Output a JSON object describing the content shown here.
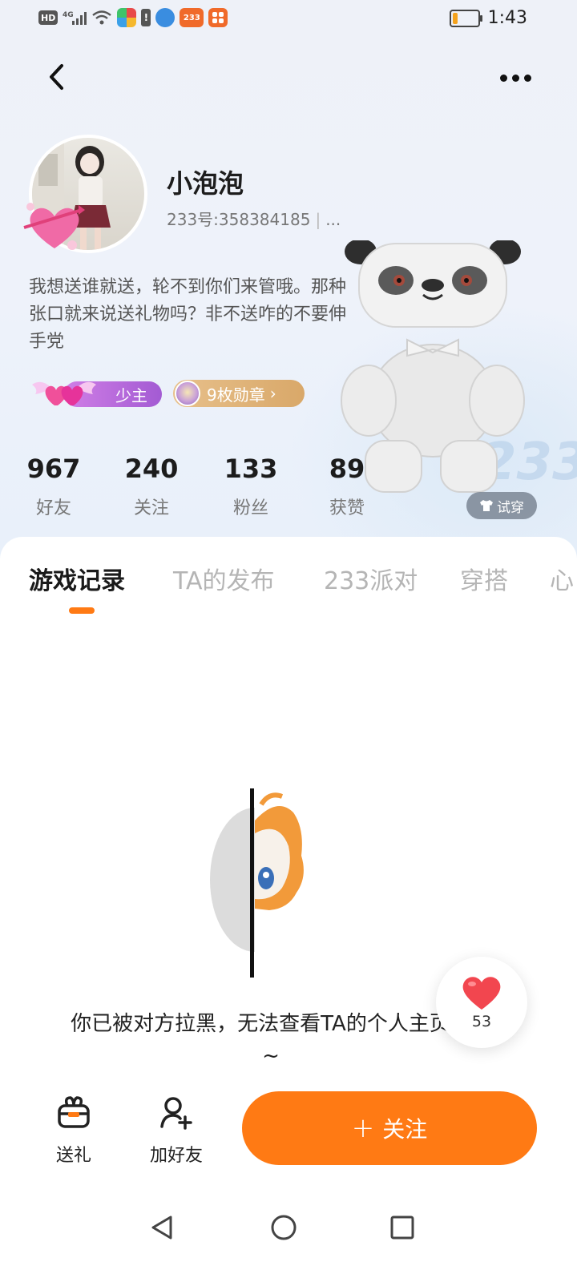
{
  "status_bar": {
    "hd": "HD",
    "signal": "4G",
    "app_badge_233": "233",
    "time": "1:43",
    "battery_percent": 20
  },
  "profile": {
    "username": "小泡泡",
    "user_id": "233号:358384185",
    "user_id_more": "...",
    "bio": "我想送谁就送，轮不到你们来管哦。那种张口就来说送礼物吗？非不送咋的不要伸手党",
    "badge_title": "少主",
    "medals_label": "9枚勋章",
    "try_on_label": "试穿",
    "bg_watermark": "233"
  },
  "stats": [
    {
      "value": "967",
      "label": "好友"
    },
    {
      "value": "240",
      "label": "关注"
    },
    {
      "value": "133",
      "label": "粉丝"
    },
    {
      "value": "89",
      "label": "获赞"
    }
  ],
  "tabs": [
    {
      "label": "游戏记录",
      "active": true
    },
    {
      "label": "TA的发布",
      "active": false
    },
    {
      "label": "233派对",
      "active": false
    },
    {
      "label": "穿搭",
      "active": false
    },
    {
      "label": "心",
      "active": false
    }
  ],
  "blocked_message": "你已被对方拉黑，无法查看TA的个人主页哦~",
  "likes": {
    "count": "53"
  },
  "actions": {
    "gift_label": "送礼",
    "add_friend_label": "加好友",
    "follow_label": "关注"
  },
  "colors": {
    "accent": "#ff7a14",
    "badge_purple": "#b463d9",
    "badge_gold": "#deae70"
  }
}
